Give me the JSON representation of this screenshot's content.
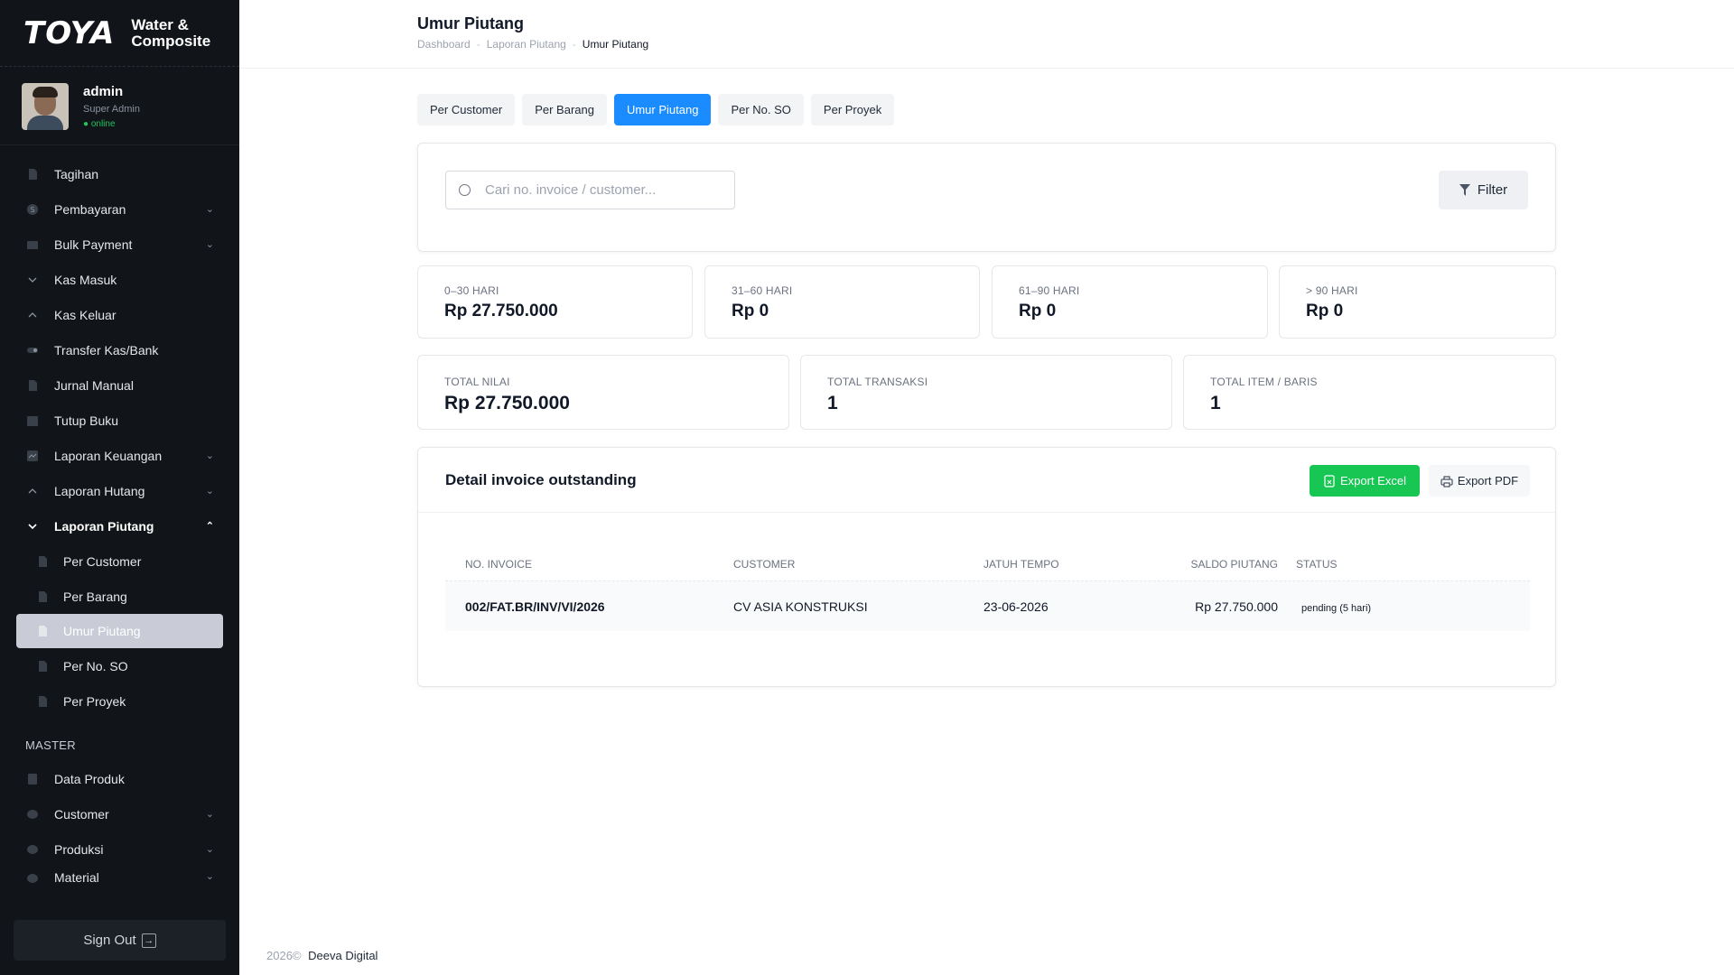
{
  "sidebar": {
    "brand_mark": "TOYA",
    "brand_sub_1": "Water &",
    "brand_sub_2": "Composite",
    "user": {
      "name": "admin",
      "role": "Super Admin",
      "status": "● online"
    },
    "items": [
      {
        "label": "Tagihan",
        "icon": "document-icon"
      },
      {
        "label": "Pembayaran",
        "icon": "dollar-icon",
        "has_chevron": true
      },
      {
        "label": "Bulk Payment",
        "icon": "wallet-icon",
        "has_chevron": true
      },
      {
        "label": "Kas Masuk",
        "icon": "arrow-down-icon"
      },
      {
        "label": "Kas Keluar",
        "icon": "arrow-up-icon"
      },
      {
        "label": "Transfer Kas/Bank",
        "icon": "transfer-icon"
      },
      {
        "label": "Jurnal Manual",
        "icon": "document-icon"
      },
      {
        "label": "Tutup Buku",
        "icon": "calendar-icon"
      },
      {
        "label": "Laporan Keuangan",
        "icon": "chart-icon",
        "has_chevron": true
      },
      {
        "label": "Laporan Hutang",
        "icon": "arrow-up-icon",
        "has_chevron": true
      },
      {
        "label": "Laporan Piutang",
        "icon": "arrow-down-icon",
        "has_chevron": true,
        "open": true
      }
    ],
    "sub_items": [
      {
        "label": "Per Customer"
      },
      {
        "label": "Per Barang"
      },
      {
        "label": "Umur Piutang",
        "active": true
      },
      {
        "label": "Per No. SO"
      },
      {
        "label": "Per Proyek"
      }
    ],
    "master_label": "MASTER",
    "master_items": [
      {
        "label": "Data Produk",
        "icon": "box-icon"
      },
      {
        "label": "Customer",
        "icon": "users-icon",
        "has_chevron": true
      },
      {
        "label": "Produksi",
        "icon": "factory-icon",
        "has_chevron": true
      },
      {
        "label": "Material",
        "icon": "layers-icon",
        "has_chevron": true
      }
    ],
    "signout": "Sign Out"
  },
  "header": {
    "title": "Umur Piutang",
    "breadcrumb": [
      "Dashboard",
      "Laporan Piutang",
      "Umur Piutang"
    ]
  },
  "tabs": [
    "Per Customer",
    "Per Barang",
    "Umur Piutang",
    "Per No. SO",
    "Per Proyek"
  ],
  "active_tab": "Umur Piutang",
  "search": {
    "placeholder": "Cari no. invoice / customer...",
    "value": ""
  },
  "filter_label": "Filter",
  "aging": [
    {
      "label": "0–30 HARI",
      "value": "Rp 27.750.000"
    },
    {
      "label": "31–60 HARI",
      "value": "Rp 0"
    },
    {
      "label": "61–90 HARI",
      "value": "Rp 0"
    },
    {
      "label": "> 90 HARI",
      "value": "Rp 0"
    }
  ],
  "totals": [
    {
      "label": "TOTAL NILAI",
      "value": "Rp 27.750.000"
    },
    {
      "label": "TOTAL TRANSAKSI",
      "value": "1"
    },
    {
      "label": "TOTAL ITEM / BARIS",
      "value": "1"
    }
  ],
  "detail": {
    "title": "Detail invoice outstanding",
    "export_excel": "Export Excel",
    "export_pdf": "Export PDF",
    "columns": [
      "NO. INVOICE",
      "CUSTOMER",
      "JATUH TEMPO",
      "SALDO PIUTANG",
      "STATUS"
    ],
    "rows": [
      {
        "invoice": "002/FAT.BR/INV/VI/2026",
        "customer": "CV ASIA KONSTRUKSI",
        "due": "23-06-2026",
        "balance": "Rp 27.750.000",
        "status": "pending (5 hari)"
      }
    ]
  },
  "footer": {
    "year": "2026©",
    "company": "Deeva Digital"
  },
  "colors": {
    "accent": "#1a8cff",
    "excel": "#17c653",
    "sidebar_bg": "#111418",
    "online": "#22c55e"
  }
}
